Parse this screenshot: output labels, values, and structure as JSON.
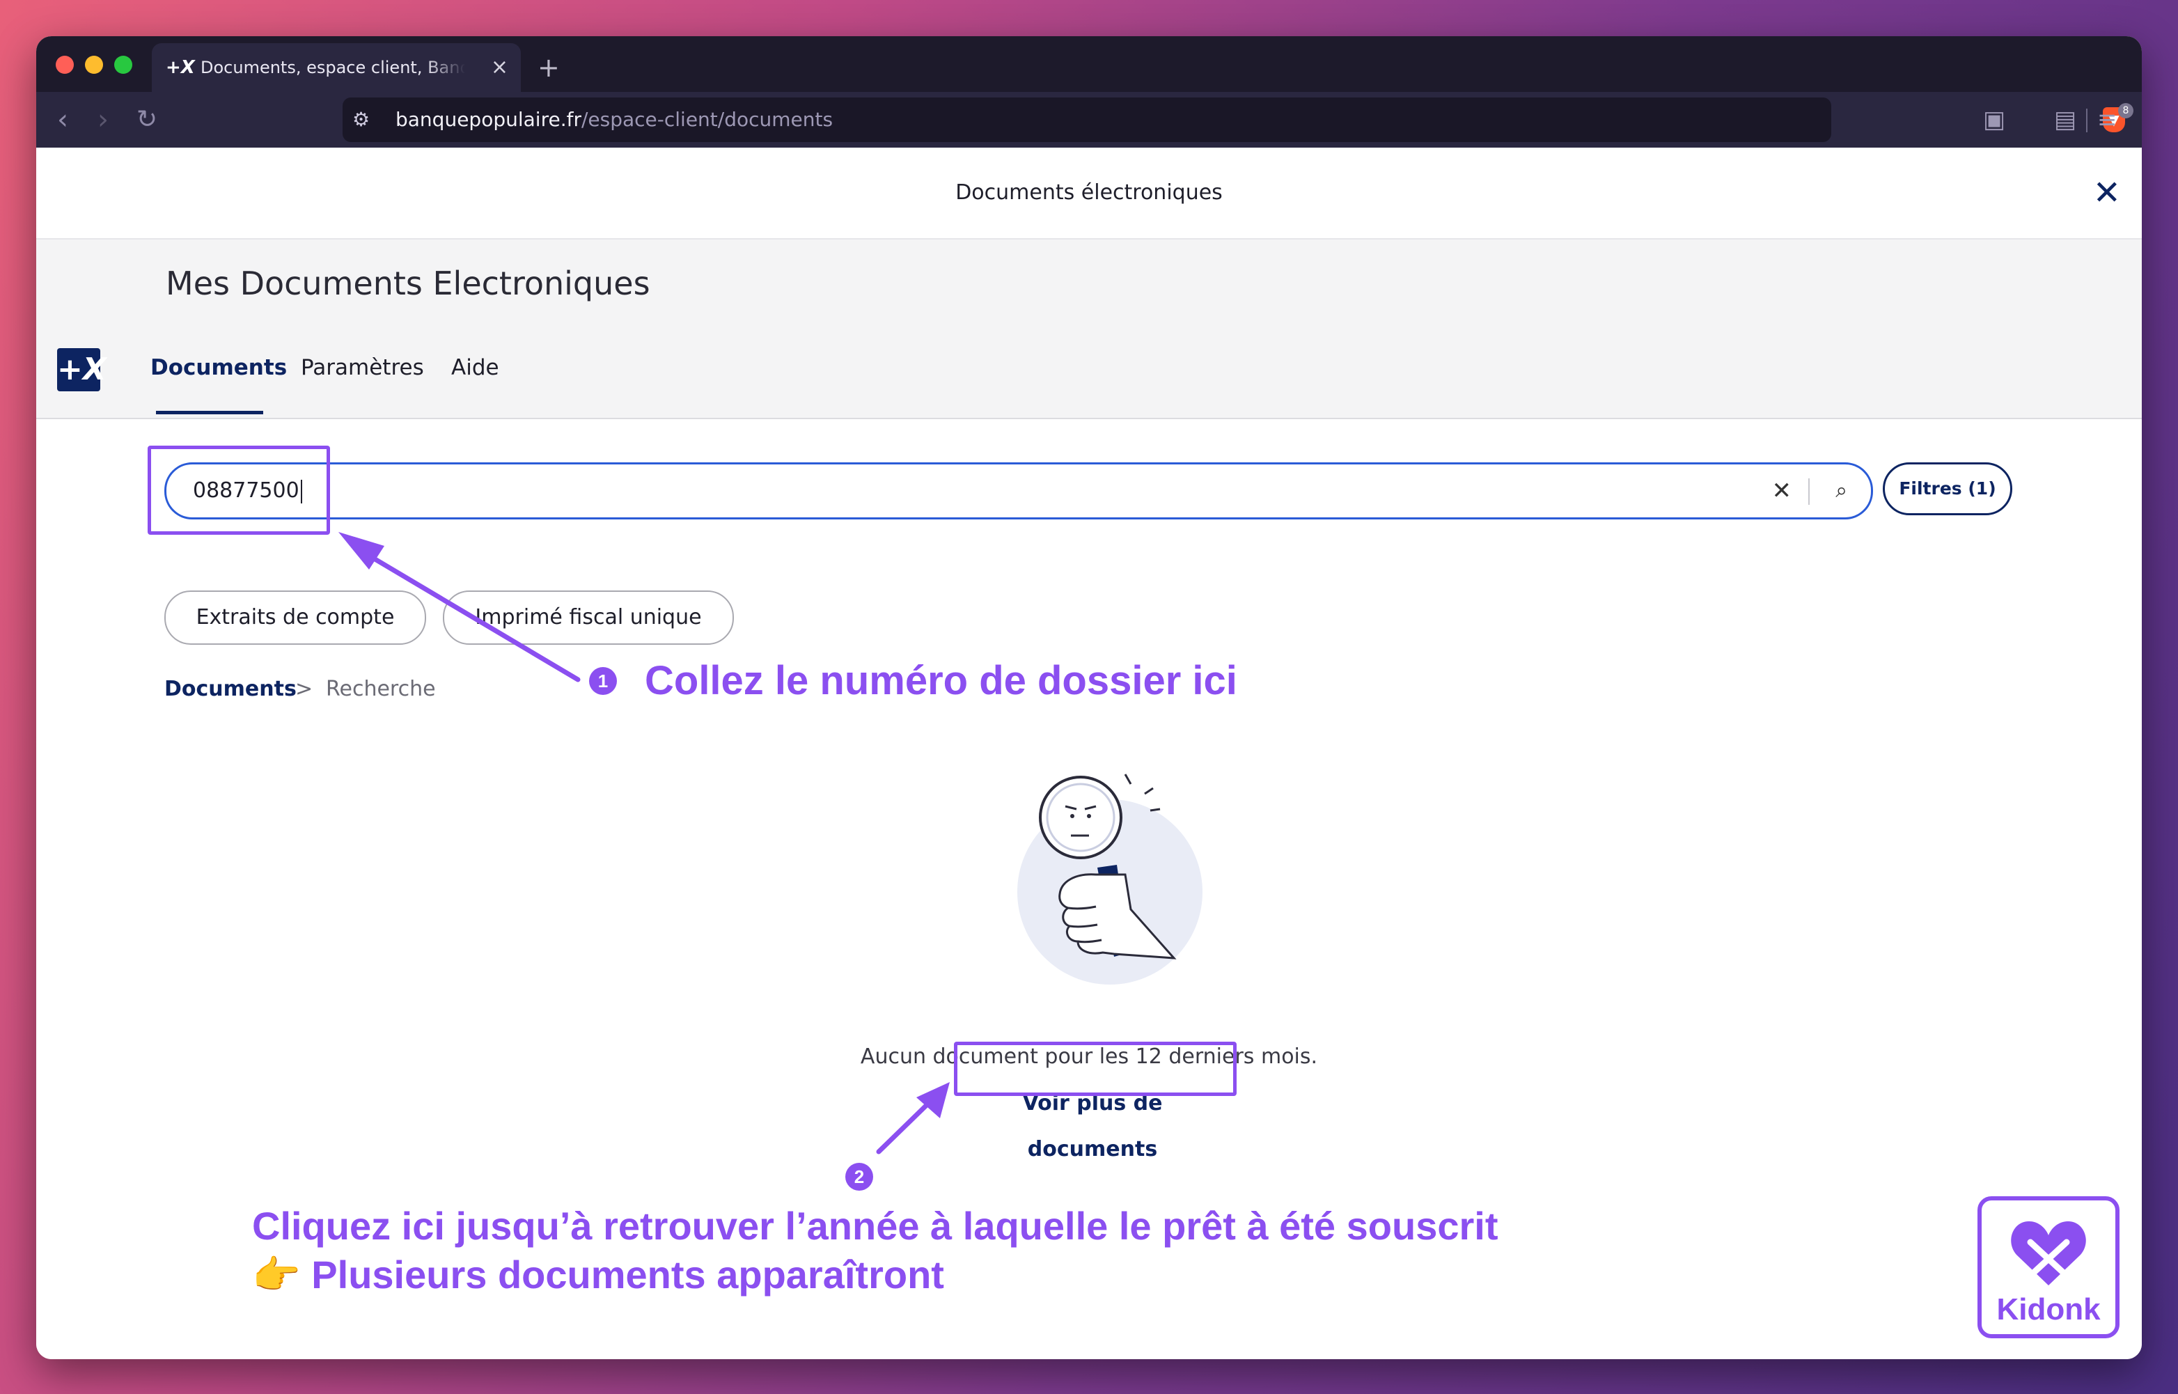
{
  "browser": {
    "tab": {
      "favicon": "+X",
      "title": "Documents, espace client, Banque Populaire",
      "close": "×"
    },
    "new_tab": "+",
    "url": {
      "domain": "banquepopulaire.fr",
      "path": "/espace-client/documents"
    },
    "shields_count": "8",
    "icons": [
      "back-icon",
      "forward-icon",
      "reload-icon",
      "site-settings-icon",
      "brave-shield-icon",
      "sidebar-icon",
      "wallet-icon",
      "menu-icon"
    ]
  },
  "modal": {
    "title": "Documents électroniques",
    "close": "✕"
  },
  "hero": {
    "title": "Mes Documents Electroniques",
    "logo": "+X"
  },
  "tabs": [
    {
      "label": "Documents",
      "active": true
    },
    {
      "label": "Paramètres",
      "active": false
    },
    {
      "label": "Aide",
      "active": false
    }
  ],
  "search": {
    "value": "08877500",
    "clear": "✕",
    "icon": "⌕"
  },
  "filters_label": "Filtres (1)",
  "chips": [
    "Extraits de compte",
    "Imprimé fiscal unique"
  ],
  "breadcrumb": {
    "root": "Documents",
    "separator": ">",
    "current": "Recherche"
  },
  "empty_state": {
    "message": "Aucun document pour les 12 derniers mois.",
    "more_link": "Voir plus de documents"
  },
  "annotations": {
    "step1": {
      "number": "1",
      "text": "Collez le numéro de dossier ici"
    },
    "step2": {
      "number": "2",
      "line1": "Cliquez ici jusqu’à retrouver l’année à laquelle le prêt à été souscrit",
      "line2_emoji": "👉",
      "line2": "Plusieurs documents apparaîtront"
    },
    "color": "#8b4ff0"
  },
  "watermark": {
    "brand": "Kidonk"
  },
  "colors": {
    "brand_navy": "#0d2461",
    "search_border": "#2a5bd7",
    "annotation": "#8b4ff0"
  }
}
